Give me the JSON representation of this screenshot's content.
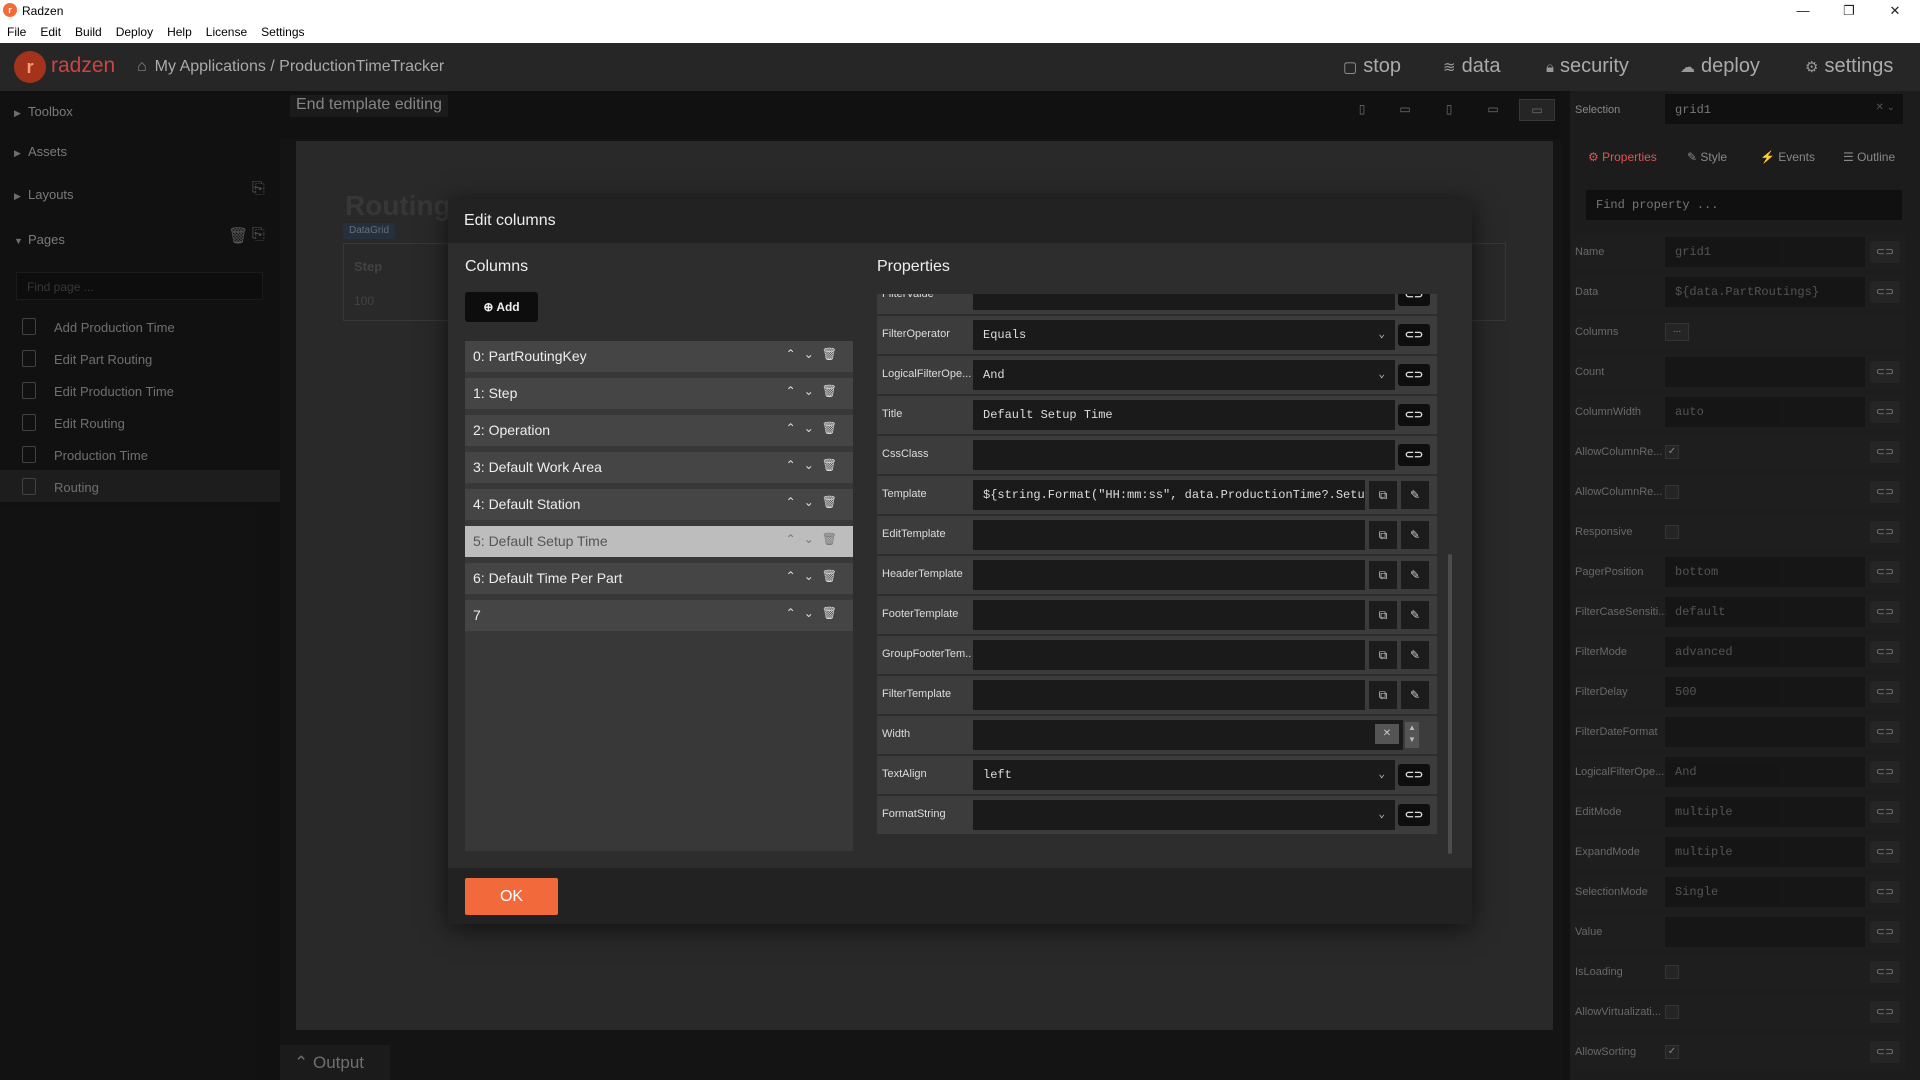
{
  "window": {
    "title": "Radzen",
    "minimize": "—",
    "maximize": "❐",
    "close": "✕"
  },
  "menu": [
    "File",
    "Edit",
    "Build",
    "Deploy",
    "Help",
    "License",
    "Settings"
  ],
  "header": {
    "logo_text": "radzen",
    "breadcrumb": "My Applications / ProductionTimeTracker",
    "nav": [
      {
        "icon": "stop-icon",
        "label": "stop"
      },
      {
        "icon": "database-icon",
        "label": "data"
      },
      {
        "icon": "lock-icon",
        "label": "security"
      },
      {
        "icon": "cloud-upload-icon",
        "label": "deploy"
      },
      {
        "icon": "gear-icon",
        "label": "settings"
      }
    ]
  },
  "sidebar": {
    "sections": [
      "Toolbox",
      "Assets",
      "Layouts",
      "Pages"
    ],
    "find_placeholder": "Find page ...",
    "pages": [
      "Add Production Time",
      "Edit Part Routing",
      "Edit Production Time",
      "Edit Routing",
      "Production Time",
      "Routing"
    ],
    "selected_page": "Routing"
  },
  "workspace": {
    "end_template": "End template editing",
    "page_title": "Routing",
    "grid_badge": "DataGrid",
    "grid_header": "Step",
    "grid_cell": "100",
    "output_label": "Output"
  },
  "dialog": {
    "title": "Edit columns",
    "columns_title": "Columns",
    "properties_title": "Properties",
    "add_label": "Add",
    "ok_label": "OK",
    "columns": [
      "0: PartRoutingKey",
      "1: Step",
      "2: Operation",
      "3: Default Work Area",
      "4: Default Station",
      "5: Default Setup Time",
      "6: Default Time Per Part",
      "7"
    ],
    "selected_column": 5,
    "properties": [
      {
        "label": "FilterValue",
        "kind": "text",
        "value": ""
      },
      {
        "label": "FilterOperator",
        "kind": "select",
        "value": "Equals"
      },
      {
        "label": "LogicalFilterOpe...",
        "kind": "select",
        "value": "And"
      },
      {
        "label": "Title",
        "kind": "text",
        "value": "Default Setup Time"
      },
      {
        "label": "CssClass",
        "kind": "text",
        "value": ""
      },
      {
        "label": "Template",
        "kind": "template",
        "value": "${string.Format(\"HH:mm:ss\", data.ProductionTime?.Setu"
      },
      {
        "label": "EditTemplate",
        "kind": "template",
        "value": ""
      },
      {
        "label": "HeaderTemplate",
        "kind": "template",
        "value": ""
      },
      {
        "label": "FooterTemplate",
        "kind": "template",
        "value": ""
      },
      {
        "label": "GroupFooterTem...",
        "kind": "template",
        "value": ""
      },
      {
        "label": "FilterTemplate",
        "kind": "template",
        "value": ""
      },
      {
        "label": "Width",
        "kind": "number",
        "value": ""
      },
      {
        "label": "TextAlign",
        "kind": "select",
        "value": "left"
      },
      {
        "label": "FormatString",
        "kind": "select",
        "value": ""
      }
    ]
  },
  "right_panel": {
    "selection_label": "Selection",
    "selection_value": "grid1",
    "tabs": [
      "Properties",
      "Style",
      "Events",
      "Outline"
    ],
    "find_placeholder": "Find property ...",
    "props": [
      {
        "label": "Name",
        "kind": "text",
        "value": "grid1"
      },
      {
        "label": "Data",
        "kind": "text",
        "value": "${data.PartRoutings}"
      },
      {
        "label": "Columns",
        "kind": "button",
        "value": "..."
      },
      {
        "label": "Count",
        "kind": "text",
        "value": ""
      },
      {
        "label": "ColumnWidth",
        "kind": "text",
        "value": "auto"
      },
      {
        "label": "AllowColumnRe...",
        "kind": "check",
        "value": "✓"
      },
      {
        "label": "AllowColumnRe...",
        "kind": "check",
        "value": ""
      },
      {
        "label": "Responsive",
        "kind": "check",
        "value": ""
      },
      {
        "label": "PagerPosition",
        "kind": "select",
        "value": "bottom"
      },
      {
        "label": "FilterCaseSensiti...",
        "kind": "select",
        "value": "default"
      },
      {
        "label": "FilterMode",
        "kind": "select",
        "value": "advanced"
      },
      {
        "label": "FilterDelay",
        "kind": "text",
        "value": "500"
      },
      {
        "label": "FilterDateFormat",
        "kind": "text",
        "value": ""
      },
      {
        "label": "LogicalFilterOpe...",
        "kind": "select",
        "value": "And"
      },
      {
        "label": "EditMode",
        "kind": "select",
        "value": "multiple"
      },
      {
        "label": "ExpandMode",
        "kind": "select",
        "value": "multiple"
      },
      {
        "label": "SelectionMode",
        "kind": "select",
        "value": "Single"
      },
      {
        "label": "Value",
        "kind": "text",
        "value": ""
      },
      {
        "label": "IsLoading",
        "kind": "check",
        "value": ""
      },
      {
        "label": "AllowVirtualizati...",
        "kind": "check",
        "value": ""
      },
      {
        "label": "AllowSorting",
        "kind": "check",
        "value": "✓"
      }
    ]
  }
}
